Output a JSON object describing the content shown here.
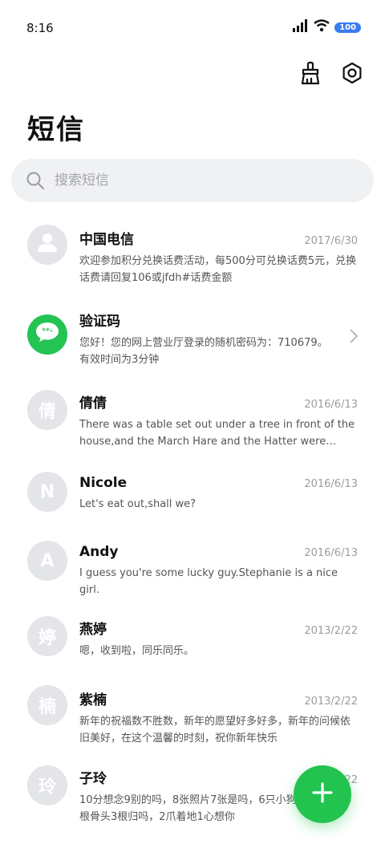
{
  "status_bar": {
    "time": "8:16",
    "battery": "100"
  },
  "header": {
    "title": "短信",
    "clean_icon": "broom-icon",
    "settings_icon": "gear-icon"
  },
  "search": {
    "placeholder": "搜索短信",
    "value": ""
  },
  "colors": {
    "accent": "#22c34f",
    "avatar_gray": "#e3e5e9",
    "battery_blue": "#3a7bf2"
  },
  "messages": [
    {
      "sender": "中国电信",
      "date": "2017/6/30",
      "preview": "欢迎参加积分兑换话费活动，每500分可兑换话费5元，兑换话费请回复106或jfdh#话费金额",
      "avatar": "person-icon"
    },
    {
      "sender": "验证码",
      "date": "",
      "preview": "您好！您的网上营业厅登录的随机密码为：710679。有效时间为3分钟",
      "avatar": "chat-bubble-icon"
    },
    {
      "sender": "倩倩",
      "date": "2016/6/13",
      "preview": "There was a table set out under a tree in front of the house,and the March Hare and the Hatter were having tea at it",
      "avatar_letter": "倩"
    },
    {
      "sender": "Nicole",
      "date": "2016/6/13",
      "preview": "Let's eat out,shall we?",
      "avatar_letter": "N"
    },
    {
      "sender": "Andy",
      "date": "2016/6/13",
      "preview": "I guess you're some lucky guy.Stephanie is a nice girl.",
      "avatar_letter": "A"
    },
    {
      "sender": "燕婷",
      "date": "2013/2/22",
      "preview": "嗯，收到啦，同乐同乐。",
      "avatar_letter": "婷"
    },
    {
      "sender": "紫楠",
      "date": "2013/2/22",
      "preview": "新年的祝福数不胜数，新年的愿望好多好多，新年的问候依旧美好，在这个温馨的时刻，祝你新年快乐",
      "avatar_letter": "楠"
    },
    {
      "sender": "子玲",
      "date": "2013/2/22",
      "preview": "10分想念9别的吗，8张照片7张是吗，6只小狗5只像吗，4根骨头3根归吗，2爪着地1心想你",
      "avatar_letter": "玲"
    }
  ],
  "fab": {
    "icon": "plus-icon"
  }
}
